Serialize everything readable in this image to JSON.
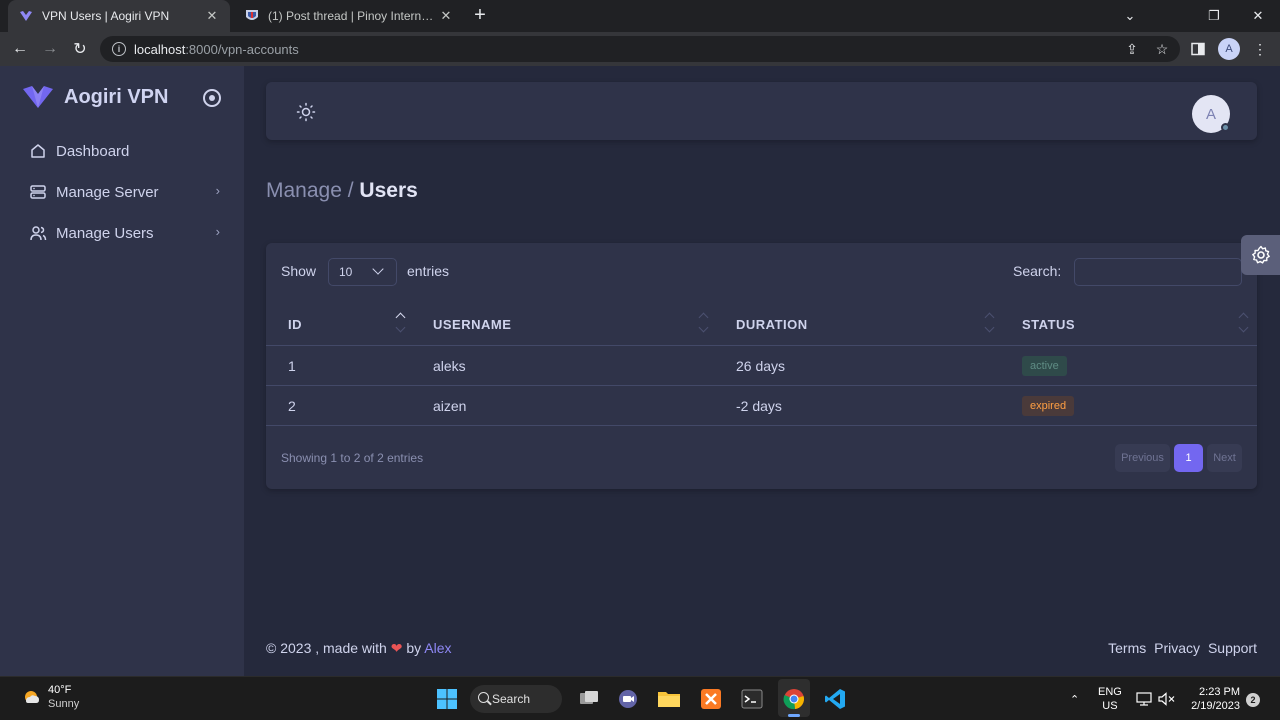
{
  "browser": {
    "tabs": [
      {
        "title": "VPN Users | Aogiri VPN",
        "active": true
      },
      {
        "title": "(1) Post thread | Pinoy Internet and...",
        "active": false
      }
    ],
    "url_host": "localhost",
    "url_path": ":8000/vpn-accounts",
    "profile_initial": "A",
    "icons": [
      "back-icon",
      "forward-icon",
      "reload-icon",
      "info-icon",
      "share-icon",
      "star-icon",
      "sidepanel-icon",
      "menu-icon"
    ]
  },
  "sidebar": {
    "brand": "Aogiri VPN",
    "items": [
      {
        "label": "Dashboard",
        "icon": "home-icon",
        "has_submenu": false
      },
      {
        "label": "Manage Server",
        "icon": "server-icon",
        "has_submenu": true
      },
      {
        "label": "Manage Users",
        "icon": "users-icon",
        "has_submenu": true
      }
    ]
  },
  "navbar": {
    "avatar_initial": "A"
  },
  "breadcrumb": {
    "parent": "Manage",
    "separator": "/",
    "current": "Users"
  },
  "table": {
    "show_label": "Show",
    "entries_value": "10",
    "entries_label": "entries",
    "search_label": "Search:",
    "search_value": "",
    "columns": [
      "ID",
      "USERNAME",
      "DURATION",
      "STATUS"
    ],
    "sorted_column": "ID",
    "rows": [
      {
        "id": "1",
        "username": "aleks",
        "duration": "26 days",
        "status": "active"
      },
      {
        "id": "2",
        "username": "aizen",
        "duration": "-2 days",
        "status": "expired"
      }
    ],
    "info": "Showing 1 to 2 of 2 entries",
    "pagination": {
      "previous": "Previous",
      "current": "1",
      "next": "Next"
    }
  },
  "footer": {
    "copyright": "© 2023 , made with",
    "by": "by",
    "author": "Alex",
    "links": [
      "Terms",
      "Privacy",
      "Support"
    ]
  },
  "taskbar": {
    "weather_temp": "40°F",
    "weather_cond": "Sunny",
    "search_label": "Search",
    "lang": "ENG",
    "region": "US",
    "time": "2:23 PM",
    "date": "2/19/2023",
    "notifications": "2"
  },
  "colors": {
    "accent": "#7367f0",
    "active_badge_bg": "#2f4a4a",
    "active_badge_text": "#5f8c84",
    "expired_badge_bg": "#4a3a3a",
    "expired_badge_text": "#ff9f43",
    "sidebar_bg": "#2f3349",
    "content_bg": "#25293c"
  }
}
